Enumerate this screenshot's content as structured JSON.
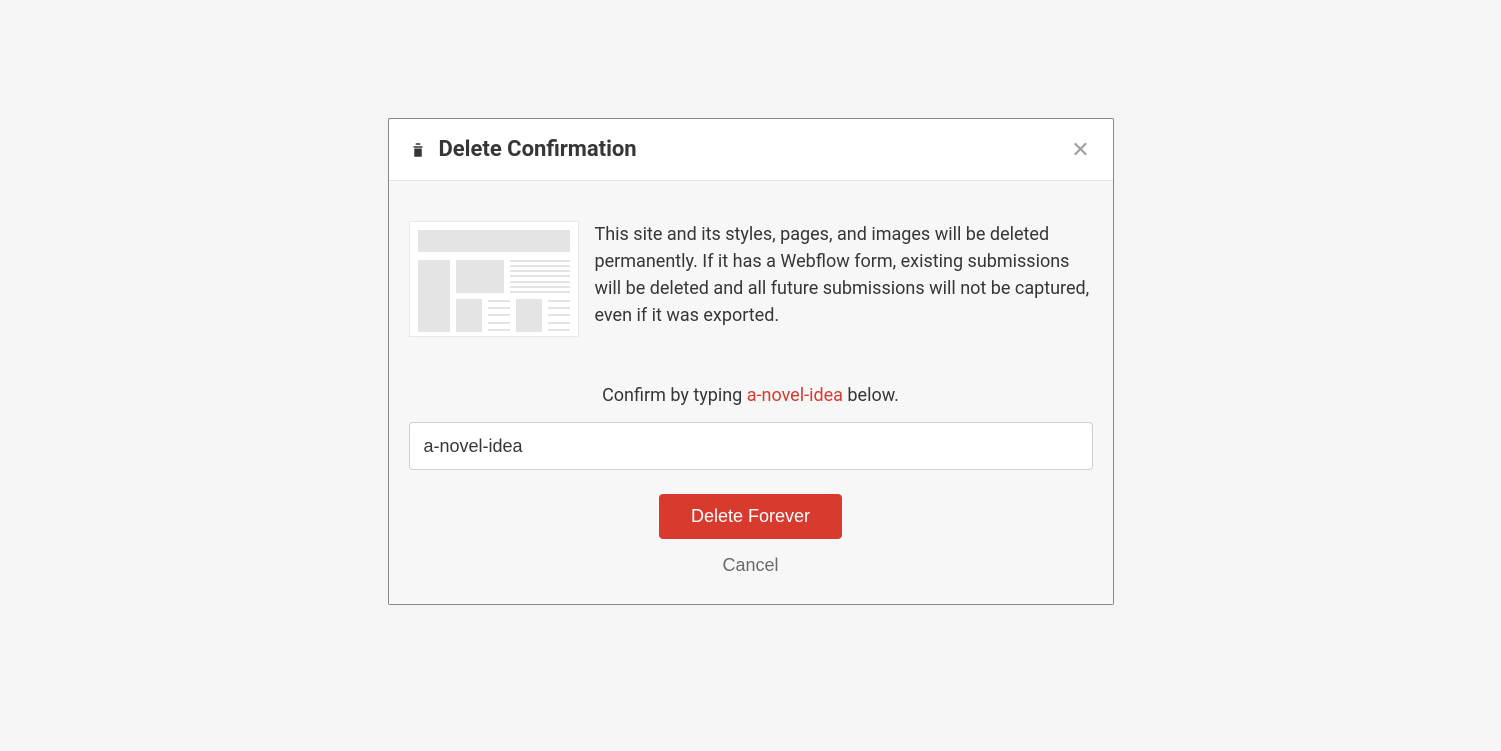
{
  "modal": {
    "title": "Delete Confirmation",
    "description": "This site and its styles, pages, and images will be deleted permanently. If it has a Webflow form, existing submissions will be deleted and all future submissions will not be captured, even if it was exported.",
    "confirm_prefix": "Confirm by typing ",
    "confirm_slug": "a-novel-idea",
    "confirm_suffix": " below.",
    "input_value": "a-novel-idea",
    "delete_label": "Delete Forever",
    "cancel_label": "Cancel"
  },
  "colors": {
    "danger": "#d83a2e",
    "text": "#363636"
  }
}
